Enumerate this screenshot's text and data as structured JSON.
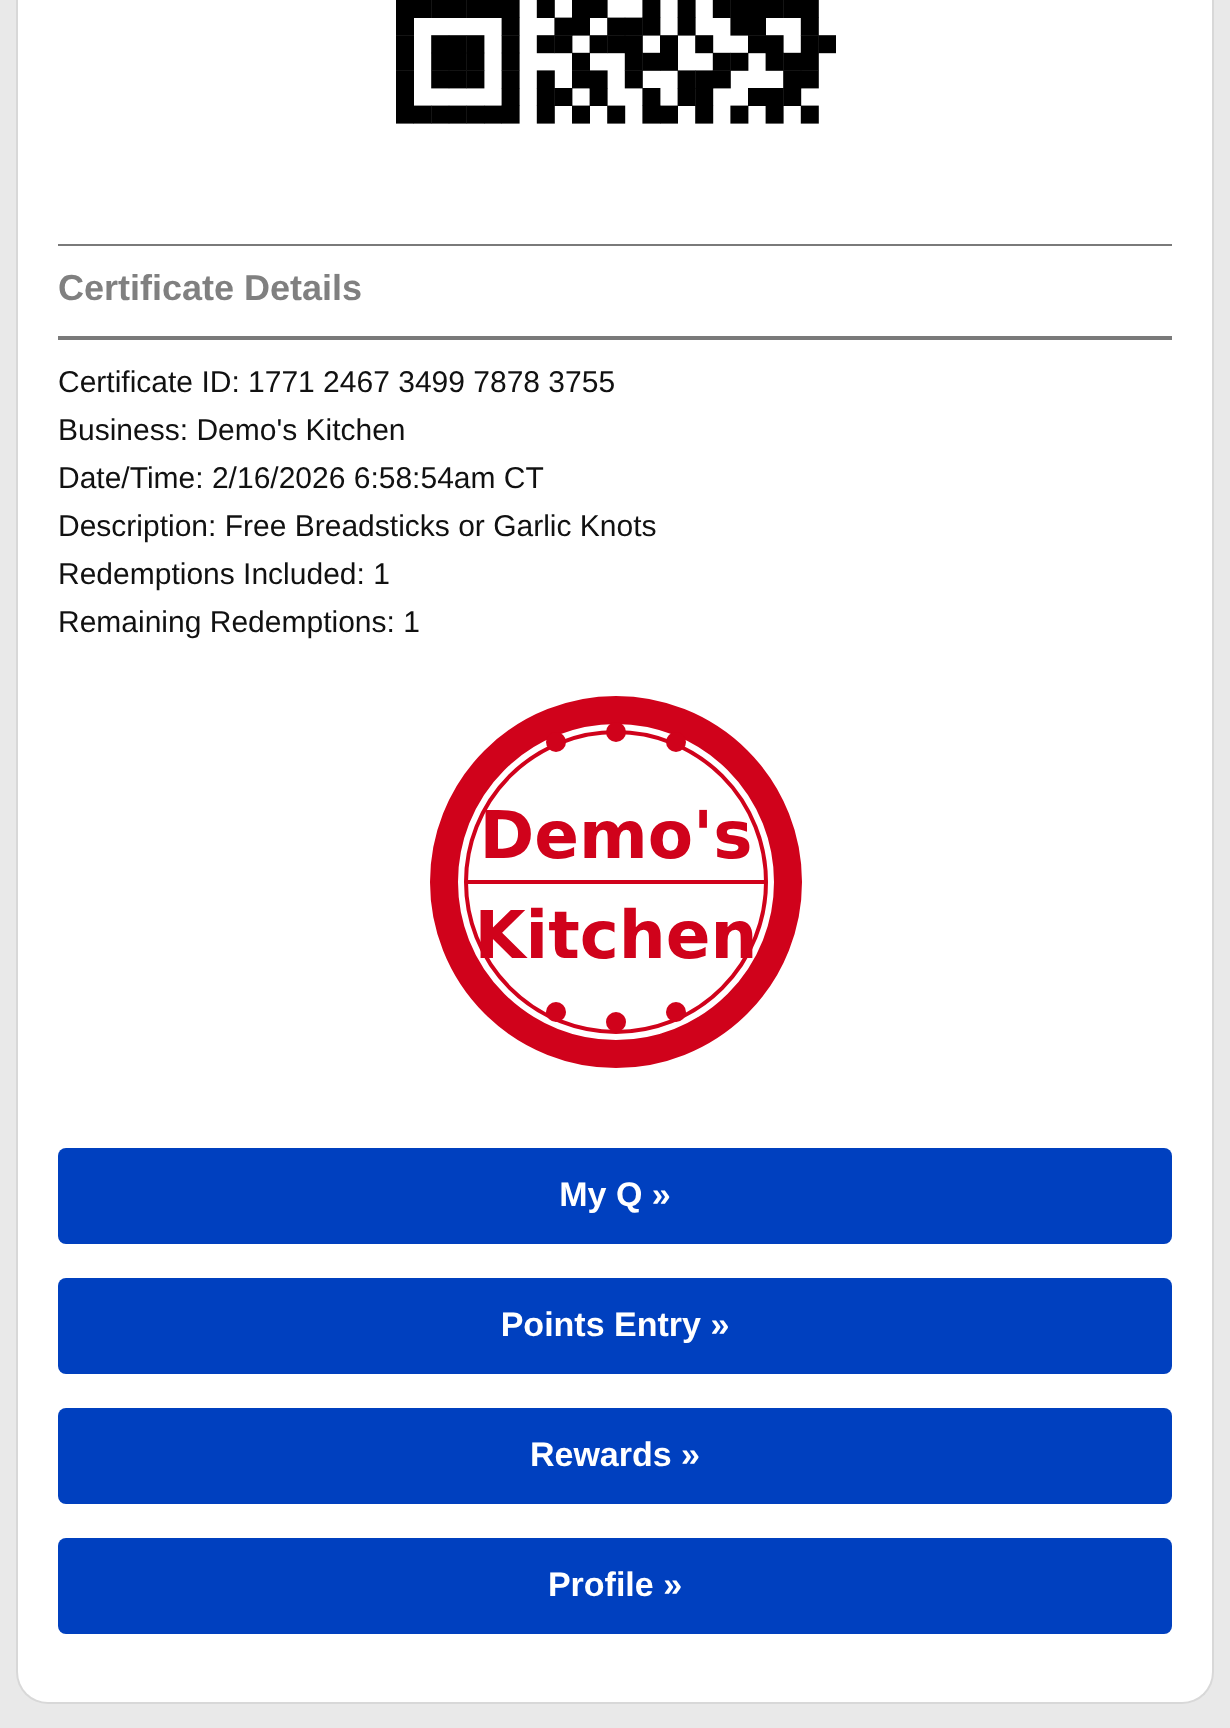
{
  "section_title": "Certificate Details",
  "details": [
    "Certificate ID: 1771 2467 3499 7878 3755",
    "Business: Demo's Kitchen",
    "Date/Time: 2/16/2026 6:58:54am CT",
    "Description: Free Breadsticks or Garlic Knots",
    "Redemptions Included: 1",
    "Remaining Redemptions: 1"
  ],
  "logo": {
    "line_1": "Demo's",
    "line_2": "Kitchen"
  },
  "buttons": [
    "My Q »",
    "Points Entry »",
    "Rewards »",
    "Profile »"
  ]
}
